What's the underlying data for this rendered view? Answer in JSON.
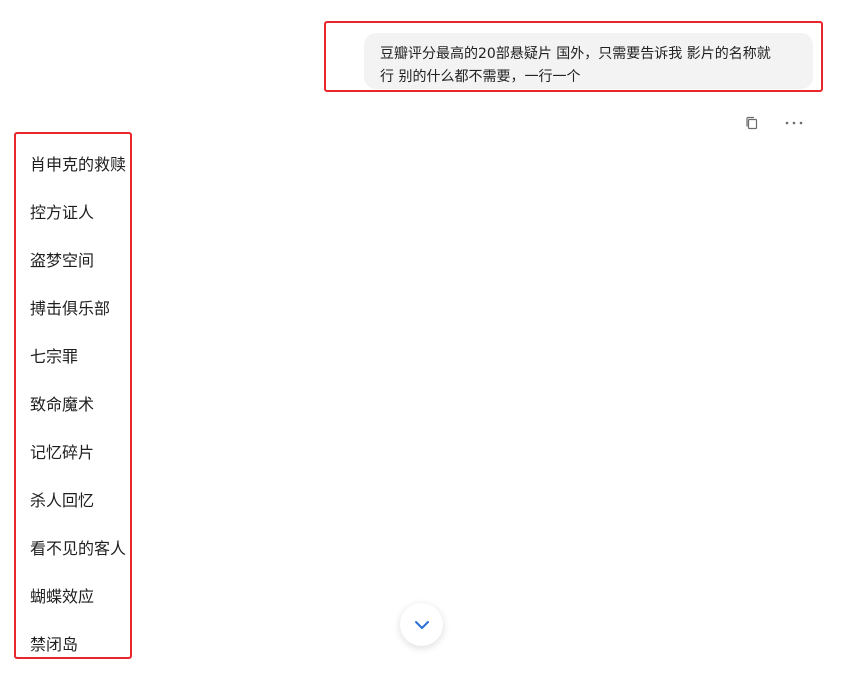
{
  "conversation": {
    "user_message": {
      "line1": "豆瓣评分最高的20部悬疑片 国外，只需要告诉我 影片的名称就",
      "line2": "行 别的什么都不需要，一行一个"
    },
    "actions": {
      "copy_icon": "copy-icon",
      "more_icon": "more-icon"
    },
    "answer_items": [
      "肖申克的救赎",
      "控方证人",
      "盗梦空间",
      "搏击俱乐部",
      "七宗罪",
      "致命魔术",
      "记忆碎片",
      "杀人回忆",
      "看不见的客人",
      "蝴蝶效应",
      "禁闭岛"
    ]
  },
  "colors": {
    "highlight": "#e8262b",
    "bubble_bg": "#f3f3f3",
    "accent": "#2a6fdb"
  }
}
